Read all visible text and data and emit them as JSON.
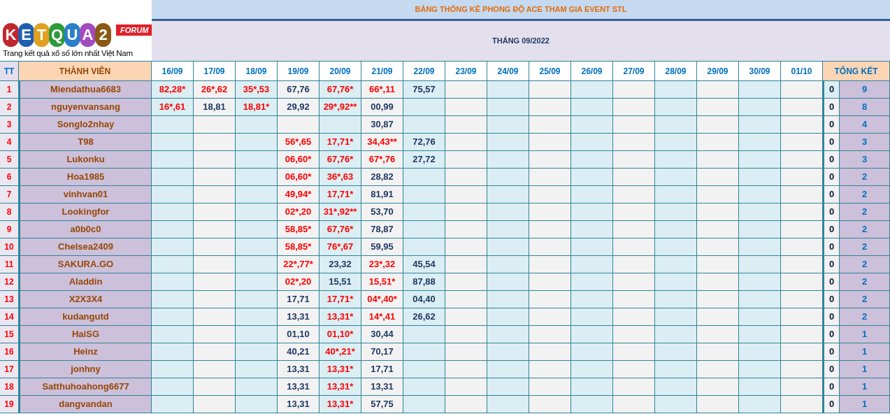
{
  "logo": {
    "letters": [
      {
        "text": "K",
        "color": "#c0282d"
      },
      {
        "text": "E",
        "color": "#1f5fb0"
      },
      {
        "text": "T",
        "color": "#e0a020"
      },
      {
        "text": "Q",
        "color": "#2e9a3a"
      },
      {
        "text": "U",
        "color": "#2a7fc8"
      },
      {
        "text": "A",
        "color": "#a24bc0"
      },
      {
        "text": "2",
        "color": "#8a5a14"
      }
    ],
    "badge": "FORUM",
    "tagline": "Trang kết quả xổ số lớn nhất Việt Nam"
  },
  "title": "BẢNG THỐNG KÊ PHONG ĐỘ ACE THAM GIA EVENT STL",
  "month": "THÁNG 09/2022",
  "columns": {
    "index": "TT",
    "member": "THÀNH VIÊN",
    "dates": [
      "16/09",
      "17/09",
      "18/09",
      "19/09",
      "20/09",
      "21/09",
      "22/09",
      "23/09",
      "24/09",
      "25/09",
      "26/09",
      "27/09",
      "28/09",
      "29/09",
      "30/09",
      "01/10"
    ],
    "summary": "TỔNG KẾT"
  },
  "rows": [
    {
      "tt": "1",
      "name": "Miendathua6683",
      "cells": [
        {
          "text": "82,28*",
          "marked": true
        },
        {
          "text": "26*,62",
          "marked": true
        },
        {
          "text": "35*,53",
          "marked": true
        },
        {
          "text": "67,76",
          "marked": false
        },
        {
          "text": "67,76*",
          "marked": true
        },
        {
          "text": "66*,11",
          "marked": true
        },
        {
          "text": "75,57",
          "marked": false
        }
      ],
      "zero": "0",
      "total": "9"
    },
    {
      "tt": "2",
      "name": "nguyenvansang",
      "cells": [
        {
          "text": "16*,61",
          "marked": true
        },
        {
          "text": "18,81",
          "marked": false
        },
        {
          "text": "18,81*",
          "marked": true
        },
        {
          "text": "29,92",
          "marked": false
        },
        {
          "text": "29*,92**",
          "marked": true
        },
        {
          "text": "00,99",
          "marked": false
        }
      ],
      "zero": "0",
      "total": "8"
    },
    {
      "tt": "3",
      "name": "Songlo2nhay",
      "cells": [
        null,
        null,
        null,
        null,
        null,
        {
          "text": "30,87",
          "marked": false
        }
      ],
      "zero": "0",
      "total": "4"
    },
    {
      "tt": "4",
      "name": "T98",
      "cells": [
        null,
        null,
        null,
        {
          "text": "56*,65",
          "marked": true
        },
        {
          "text": "17,71*",
          "marked": true
        },
        {
          "text": "34,43**",
          "marked": true
        },
        {
          "text": "72,76",
          "marked": false
        }
      ],
      "zero": "0",
      "total": "3"
    },
    {
      "tt": "5",
      "name": "Lukonku",
      "cells": [
        null,
        null,
        null,
        {
          "text": "06,60*",
          "marked": true
        },
        {
          "text": "67,76*",
          "marked": true
        },
        {
          "text": "67*,76",
          "marked": true
        },
        {
          "text": "27,72",
          "marked": false
        }
      ],
      "zero": "0",
      "total": "3"
    },
    {
      "tt": "6",
      "name": "Hoa1985",
      "cells": [
        null,
        null,
        null,
        {
          "text": "06,60*",
          "marked": true
        },
        {
          "text": "36*,63",
          "marked": true
        },
        {
          "text": "28,82",
          "marked": false
        }
      ],
      "zero": "0",
      "total": "2"
    },
    {
      "tt": "7",
      "name": "vinhvan01",
      "cells": [
        null,
        null,
        null,
        {
          "text": "49,94*",
          "marked": true
        },
        {
          "text": "17,71*",
          "marked": true
        },
        {
          "text": "81,91",
          "marked": false
        }
      ],
      "zero": "0",
      "total": "2"
    },
    {
      "tt": "8",
      "name": "Lookingfor",
      "cells": [
        null,
        null,
        null,
        {
          "text": "02*,20",
          "marked": true
        },
        {
          "text": "31*,92**",
          "marked": true
        },
        {
          "text": "53,70",
          "marked": false
        }
      ],
      "zero": "0",
      "total": "2"
    },
    {
      "tt": "9",
      "name": "a0b0c0",
      "cells": [
        null,
        null,
        null,
        {
          "text": "58,85*",
          "marked": true
        },
        {
          "text": "67,76*",
          "marked": true
        },
        {
          "text": "78,87",
          "marked": false
        }
      ],
      "zero": "0",
      "total": "2"
    },
    {
      "tt": "10",
      "name": "Chelsea2409",
      "cells": [
        null,
        null,
        null,
        {
          "text": "58,85*",
          "marked": true
        },
        {
          "text": "76*,67",
          "marked": true
        },
        {
          "text": "59,95",
          "marked": false
        }
      ],
      "zero": "0",
      "total": "2"
    },
    {
      "tt": "11",
      "name": "SAKURA.GO",
      "cells": [
        null,
        null,
        null,
        {
          "text": "22*,77*",
          "marked": true
        },
        {
          "text": "23,32",
          "marked": false
        },
        {
          "text": "23*,32",
          "marked": true
        },
        {
          "text": "45,54",
          "marked": false
        }
      ],
      "zero": "0",
      "total": "2"
    },
    {
      "tt": "12",
      "name": "Aladdin",
      "cells": [
        null,
        null,
        null,
        {
          "text": "02*,20",
          "marked": true
        },
        {
          "text": "15,51",
          "marked": false
        },
        {
          "text": "15,51*",
          "marked": true
        },
        {
          "text": "87,88",
          "marked": false
        }
      ],
      "zero": "0",
      "total": "2"
    },
    {
      "tt": "13",
      "name": "X2X3X4",
      "cells": [
        null,
        null,
        null,
        {
          "text": "17,71",
          "marked": false
        },
        {
          "text": "17,71*",
          "marked": true
        },
        {
          "text": "04*,40*",
          "marked": true
        },
        {
          "text": "04,40",
          "marked": false
        }
      ],
      "zero": "0",
      "total": "2"
    },
    {
      "tt": "14",
      "name": "kudangutd",
      "cells": [
        null,
        null,
        null,
        {
          "text": "13,31",
          "marked": false
        },
        {
          "text": "13,31*",
          "marked": true
        },
        {
          "text": "14*,41",
          "marked": true
        },
        {
          "text": "26,62",
          "marked": false
        }
      ],
      "zero": "0",
      "total": "2"
    },
    {
      "tt": "15",
      "name": "HaiSG",
      "cells": [
        null,
        null,
        null,
        {
          "text": "01,10",
          "marked": false
        },
        {
          "text": "01,10*",
          "marked": true
        },
        {
          "text": "30,44",
          "marked": false
        }
      ],
      "zero": "0",
      "total": "1"
    },
    {
      "tt": "16",
      "name": "Heinz",
      "cells": [
        null,
        null,
        null,
        {
          "text": "40,21",
          "marked": false
        },
        {
          "text": "40*,21*",
          "marked": true
        },
        {
          "text": "70,17",
          "marked": false
        }
      ],
      "zero": "0",
      "total": "1"
    },
    {
      "tt": "17",
      "name": "jonhny",
      "cells": [
        null,
        null,
        null,
        {
          "text": "13,31",
          "marked": false
        },
        {
          "text": "13,31*",
          "marked": true
        },
        {
          "text": "17,71",
          "marked": false
        }
      ],
      "zero": "0",
      "total": "1"
    },
    {
      "tt": "18",
      "name": "Satthuhoahong6677",
      "cells": [
        null,
        null,
        null,
        {
          "text": "13,31",
          "marked": false
        },
        {
          "text": "13,31*",
          "marked": true
        },
        {
          "text": "13,31",
          "marked": false
        }
      ],
      "zero": "0",
      "total": "1"
    },
    {
      "tt": "19",
      "name": "dangvandan",
      "cells": [
        null,
        null,
        null,
        {
          "text": "13,31",
          "marked": false
        },
        {
          "text": "13,31*",
          "marked": true
        },
        {
          "text": "57,75",
          "marked": false
        }
      ],
      "zero": "0",
      "total": "1"
    }
  ]
}
